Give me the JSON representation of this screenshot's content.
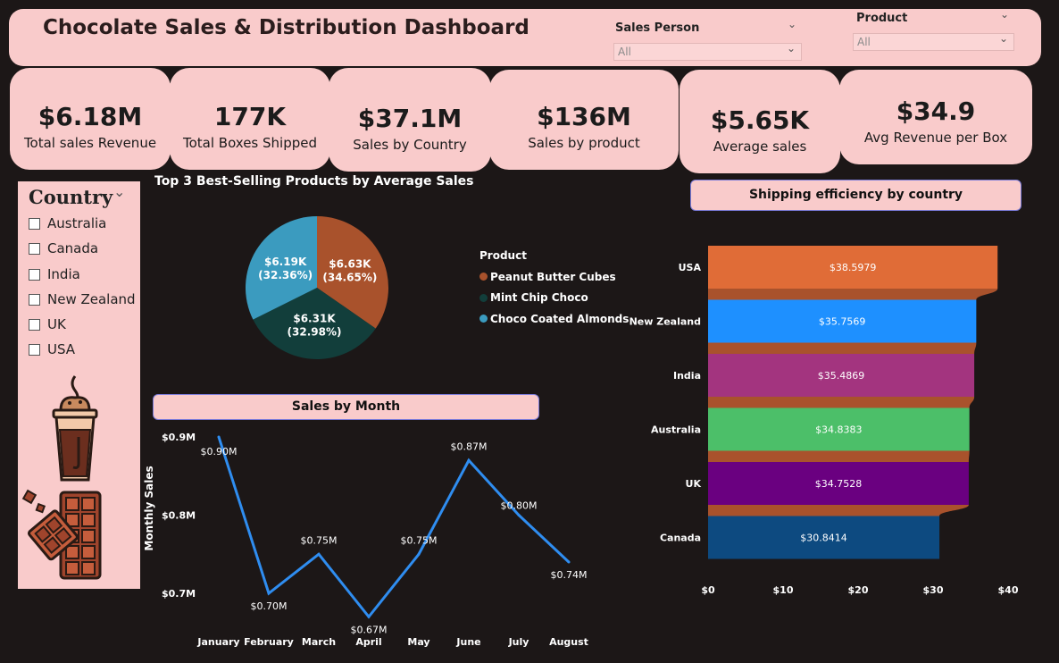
{
  "header": {
    "title": "Chocolate Sales & Distribution Dashboard",
    "sales_person": {
      "label": "Sales Person",
      "value": "All"
    },
    "product": {
      "label": "Product",
      "value": "All"
    }
  },
  "kpis": [
    {
      "value": "$6.18M",
      "label": "Total sales Revenue"
    },
    {
      "value": "177K",
      "label": "Total Boxes Shipped"
    },
    {
      "value": "$37.1M",
      "label": "Sales by Country"
    },
    {
      "value": "$136M",
      "label": "Sales by product"
    },
    {
      "value": "$5.65K",
      "label": "Average sales"
    },
    {
      "value": "$34.9",
      "label": "Avg Revenue per Box"
    }
  ],
  "country_slicer": {
    "title": "Country",
    "items": [
      "Australia",
      "Canada",
      "India",
      "New Zealand",
      "UK",
      "USA"
    ]
  },
  "pie_chart": {
    "title": "Top 3 Best-Selling Products by Average Sales",
    "legend_title": "Product"
  },
  "line_chart": {
    "title": "Sales by Month"
  },
  "bar_chart": {
    "title": "Shipping efficiency by country"
  },
  "chart_data": [
    {
      "type": "pie",
      "title": "Top 3 Best-Selling Products by Average Sales",
      "legend_title": "Product",
      "legend_position": "right",
      "slices": [
        {
          "name": "Peanut Butter Cubes",
          "value": 6.63,
          "label": "$6.63K",
          "pct": "(34.65%)",
          "color": "#a9522c"
        },
        {
          "name": "Mint Chip Choco",
          "value": 6.31,
          "label": "$6.31K",
          "pct": "(32.98%)",
          "color": "#123e3b"
        },
        {
          "name": "Choco Coated Almonds",
          "value": 6.19,
          "label": "$6.19K",
          "pct": "(32.36%)",
          "color": "#3b9bbf"
        }
      ]
    },
    {
      "type": "line",
      "title": "Sales by Month",
      "xlabel": "",
      "ylabel": "Monthly Sales",
      "ylim": [
        0.66,
        0.9
      ],
      "yticks": [
        {
          "v": 0.9,
          "label": "$0.9M"
        },
        {
          "v": 0.8,
          "label": "$0.8M"
        },
        {
          "v": 0.7,
          "label": "$0.7M"
        }
      ],
      "categories": [
        "January",
        "February",
        "March",
        "April",
        "May",
        "June",
        "July",
        "August"
      ],
      "values": [
        0.9,
        0.7,
        0.75,
        0.67,
        0.75,
        0.87,
        0.8,
        0.74
      ],
      "labels": [
        "$0.90M",
        "$0.70M",
        "$0.75M",
        "$0.67M",
        "$0.75M",
        "$0.87M",
        "$0.80M",
        "$0.74M"
      ],
      "color": "#2f8df0",
      "grid": false
    },
    {
      "type": "bar",
      "orientation": "horizontal",
      "title": "Shipping efficiency by country",
      "categories": [
        "USA",
        "New Zealand",
        "India",
        "Australia",
        "UK",
        "Canada"
      ],
      "values": [
        38.5979,
        35.7569,
        35.4869,
        34.8383,
        34.7528,
        30.8414
      ],
      "labels": [
        "$38.5979",
        "$35.7569",
        "$35.4869",
        "$34.8383",
        "$34.7528",
        "$30.8414"
      ],
      "colors": [
        "#e06c37",
        "#1e90ff",
        "#a3347f",
        "#4cbf69",
        "#6a0080",
        "#0d4a80"
      ],
      "connector_color": "#a9522c",
      "xlim": [
        0,
        40
      ],
      "xticks": [
        {
          "v": 0,
          "label": "$0"
        },
        {
          "v": 10,
          "label": "$10"
        },
        {
          "v": 20,
          "label": "$20"
        },
        {
          "v": 30,
          "label": "$30"
        },
        {
          "v": 40,
          "label": "$40"
        }
      ],
      "grid": false
    }
  ]
}
